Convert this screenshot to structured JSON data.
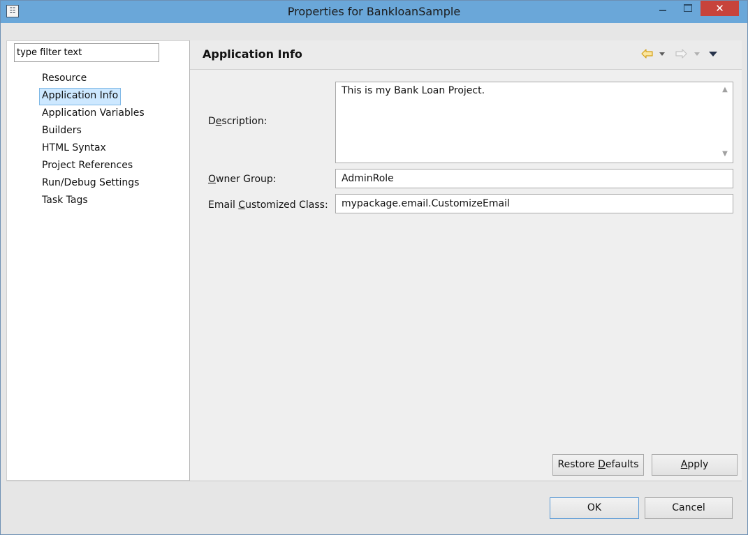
{
  "window": {
    "title": "Properties for BankloanSample",
    "icon": "properties-window-icon",
    "icon_glyph": "☷",
    "close_glyph": "✕",
    "accent_color": "#6aa7d9",
    "close_color": "#c7433b"
  },
  "filter": {
    "value": "type filter text"
  },
  "tree": {
    "items": [
      "Resource",
      "Application Info",
      "Application Variables",
      "Builders",
      "HTML Syntax",
      "Project References",
      "Run/Debug Settings",
      "Task Tags"
    ],
    "selected": "Application Info"
  },
  "page": {
    "title": "Application Info",
    "nav_icons": [
      "back-arrow-icon",
      "back-dropdown-icon",
      "forward-arrow-icon",
      "forward-dropdown-icon",
      "view-menu-icon"
    ]
  },
  "form": {
    "description": {
      "label_pre": "D",
      "label_u": "e",
      "label_post": "scription:",
      "value": "This is my Bank Loan Project."
    },
    "owner_group": {
      "label_pre": "",
      "label_u": "O",
      "label_post": "wner Group:",
      "value": "AdminRole"
    },
    "email_class": {
      "label_pre": "Email ",
      "label_u": "C",
      "label_post": "ustomized Class:",
      "value": "mypackage.email.CustomizeEmail"
    }
  },
  "buttons": {
    "restore_pre": "Restore ",
    "restore_u": "D",
    "restore_post": "efaults",
    "apply_u": "A",
    "apply_post": "pply",
    "ok": "OK",
    "cancel": "Cancel"
  }
}
